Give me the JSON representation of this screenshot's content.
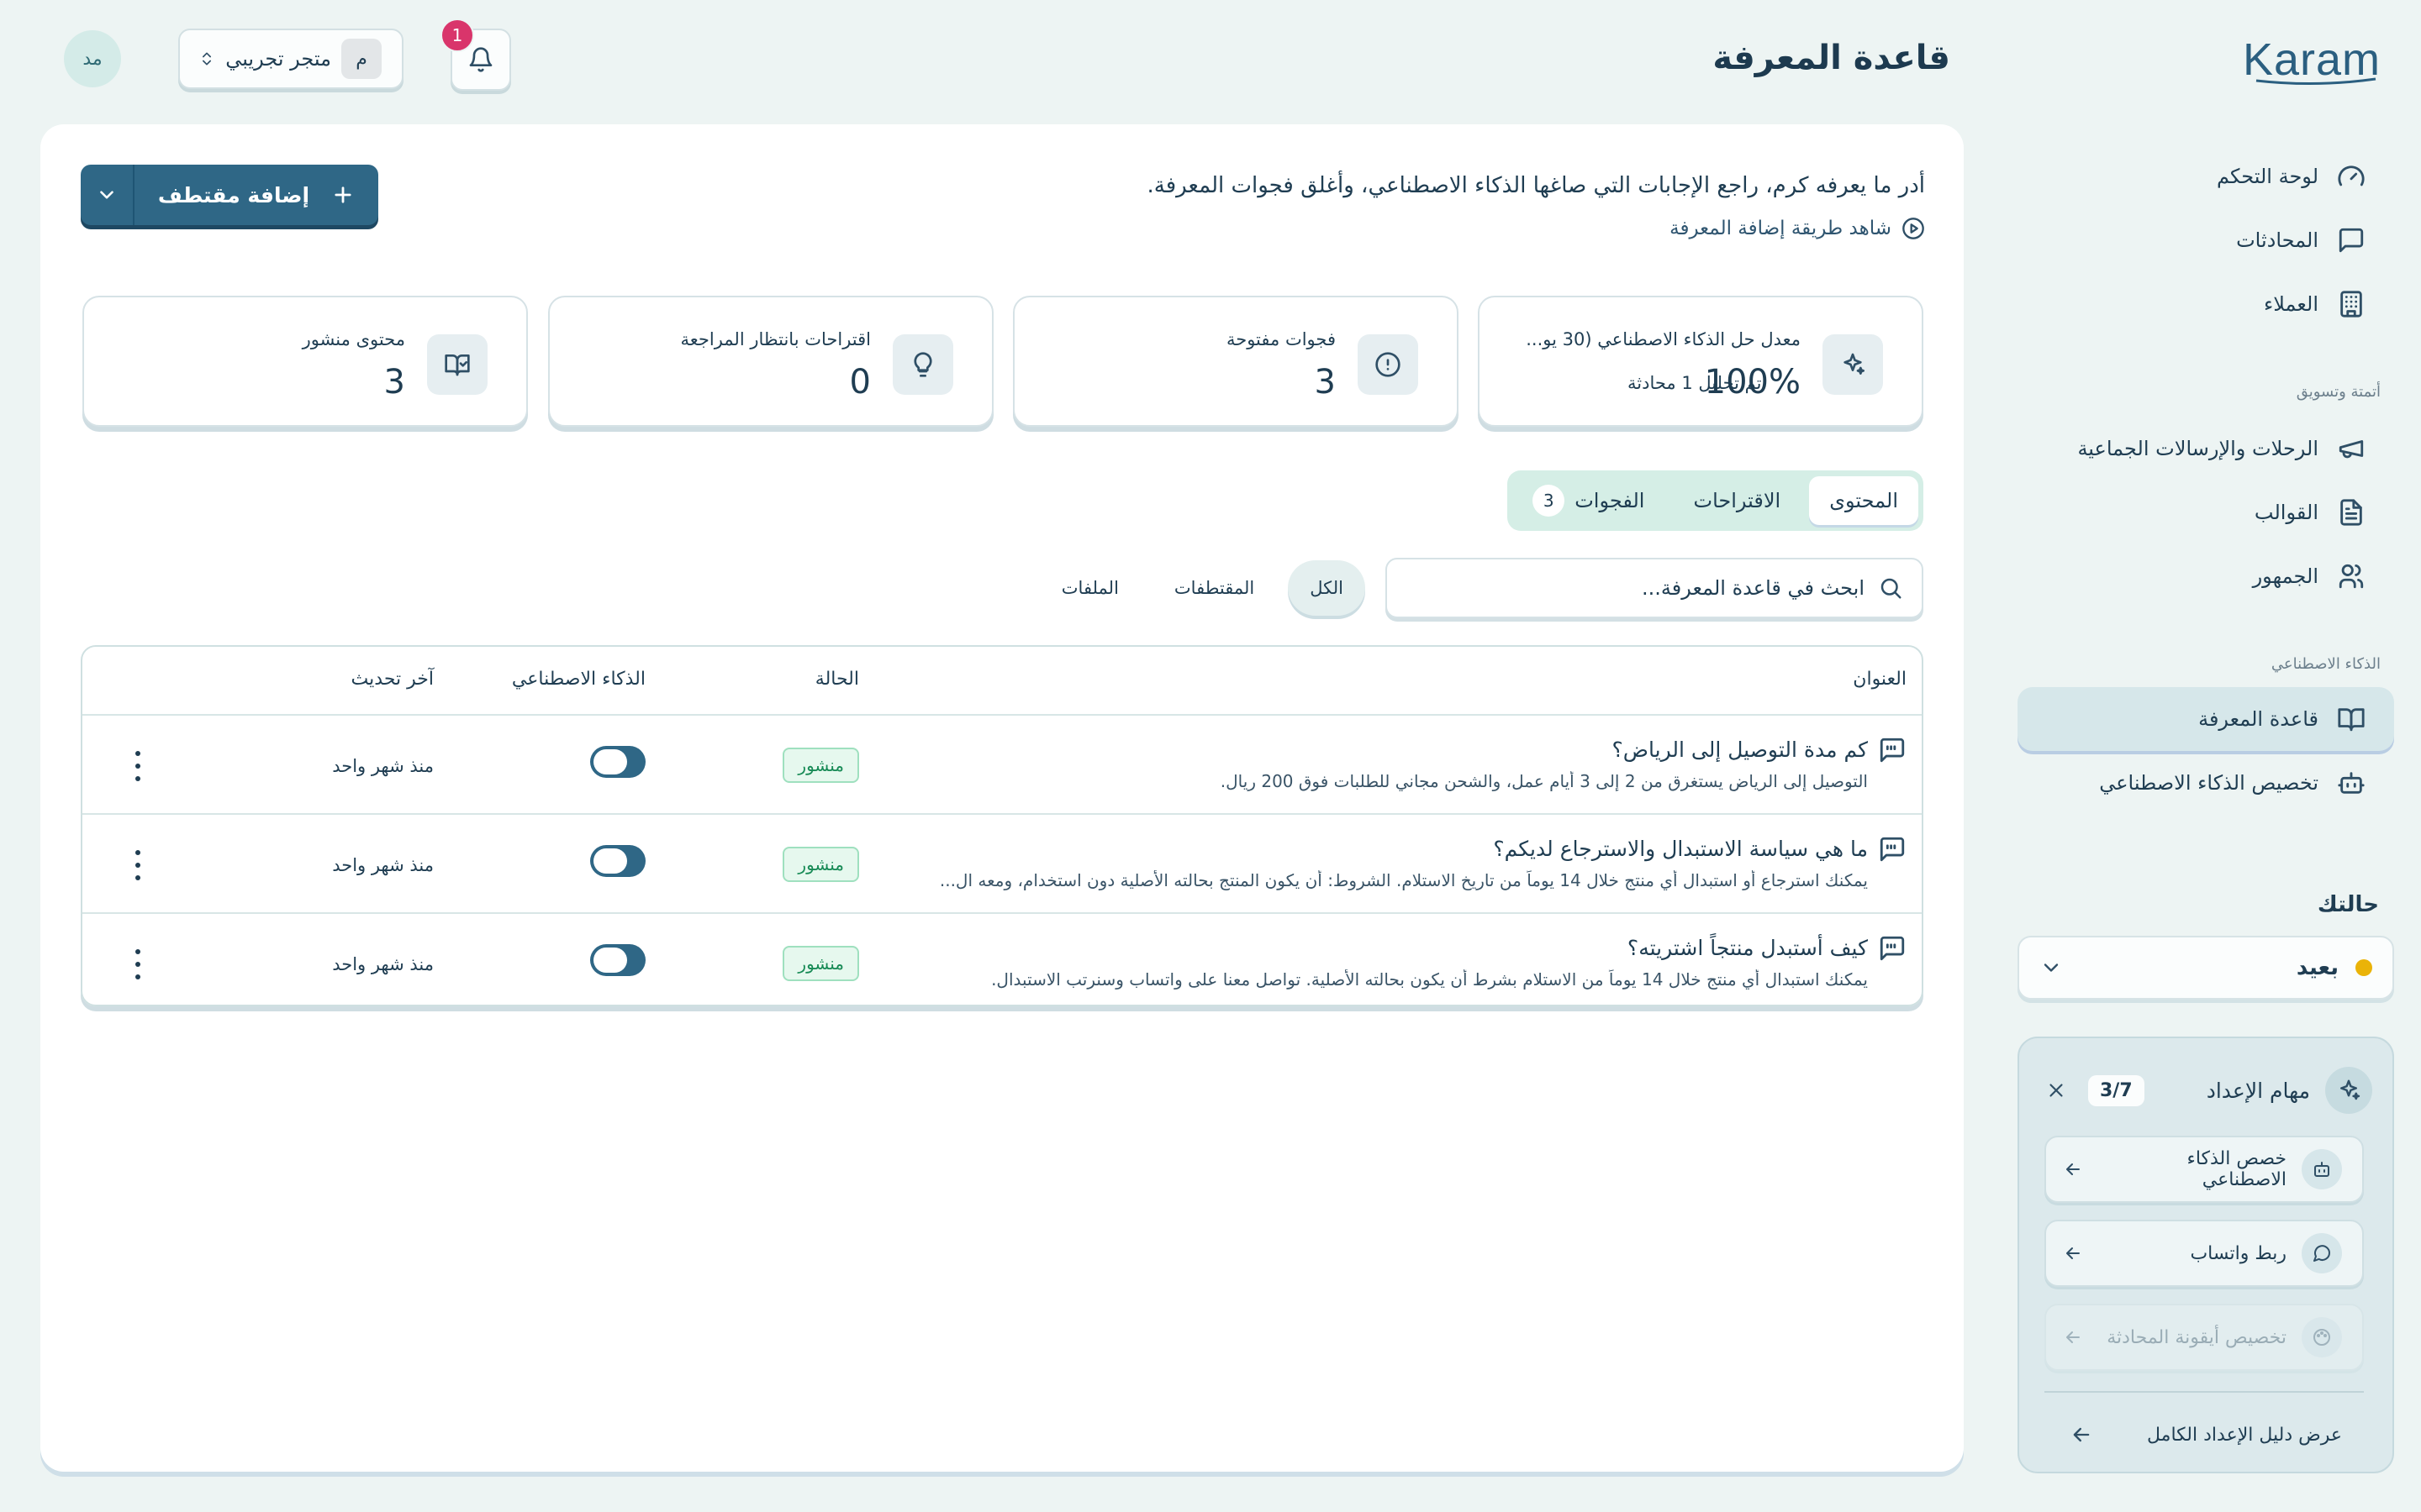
{
  "app": {
    "logo": "Karam"
  },
  "sidebar": {
    "items": [
      {
        "label": "لوحة التحكم",
        "icon": "gauge-icon"
      },
      {
        "label": "المحادثات",
        "icon": "chat-icon"
      },
      {
        "label": "العملاء",
        "icon": "building-icon"
      },
      {
        "label": "الرحلات والإرسالات الجماعية",
        "icon": "megaphone-icon"
      },
      {
        "label": "القوالب",
        "icon": "document-icon"
      },
      {
        "label": "الجمهور",
        "icon": "users-icon"
      },
      {
        "label": "قاعدة المعرفة",
        "icon": "book-icon",
        "active": true
      },
      {
        "label": "تخصيص الذكاء الاصطناعي",
        "icon": "bot-icon"
      }
    ],
    "section_automation": "أتمتة وتسويق",
    "section_ai": "الذكاء الاصطناعي",
    "status": {
      "title": "حالتك",
      "value": "بعيد",
      "dot_color": "#eab308"
    },
    "setup": {
      "title": "مهام الإعداد",
      "count": "3/7",
      "tasks": [
        "خصص الذكاء الاصطناعي",
        "ربط واتساب",
        "تخصيص أيقونة المحادثة"
      ],
      "footer": "عرض دليل الإعداد الكامل"
    }
  },
  "header": {
    "title": "قاعدة المعرفة",
    "notifications": "1",
    "store_avatar": "م",
    "store_name": "متجر تجريبي",
    "user_initials": "مد"
  },
  "main": {
    "intro": "أدر ما يعرفه كرم، راجع الإجابات التي صاغها الذكاء الاصطناعي، وأغلق فجوات المعرفة.",
    "howto": "شاهد طريقة إضافة المعرفة",
    "add_button": "إضافة مقتطف",
    "stats": [
      {
        "label": "معدل حل الذكاء الاصطناعي (30 يو...",
        "value": "100%",
        "sub": "تم تحليل 1 محادثة",
        "icon": "sparkles-icon"
      },
      {
        "label": "فجوات مفتوحة",
        "value": "3",
        "icon": "alert-circle-icon"
      },
      {
        "label": "اقتراحات بانتظار المراجعة",
        "value": "0",
        "icon": "lightbulb-icon"
      },
      {
        "label": "محتوى منشور",
        "value": "3",
        "icon": "book-check-icon"
      }
    ],
    "tabs": [
      {
        "label": "المحتوى",
        "active": true
      },
      {
        "label": "الاقتراحات"
      },
      {
        "label": "الفجوات",
        "badge": "3"
      }
    ],
    "search_placeholder": "ابحث في قاعدة المعرفة...",
    "filters": [
      {
        "label": "الكل",
        "active": true
      },
      {
        "label": "المقتطفات"
      },
      {
        "label": "الملفات"
      }
    ],
    "table": {
      "headers": {
        "title": "العنوان",
        "status": "الحالة",
        "ai": "الذكاء الاصطناعي",
        "updated": "آخر تحديث"
      },
      "rows": [
        {
          "title": "كم مدة التوصيل إلى الرياض؟",
          "desc": "التوصيل إلى الرياض يستغرق من 2 إلى 3 أيام عمل، والشحن مجاني للطلبات فوق 200 ريال.",
          "status": "منشور",
          "updated": "منذ شهر واحد"
        },
        {
          "title": "ما هي سياسة الاستبدال والاسترجاع لديكم؟",
          "desc": "يمكنك استرجاع أو استبدال أي منتج خلال 14 يوماً من تاريخ الاستلام. الشروط: أن يكون المنتج بحالته الأصلية دون استخدام، ومعه ال...",
          "status": "منشور",
          "updated": "منذ شهر واحد"
        },
        {
          "title": "كيف أستبدل منتجاً اشتريته؟",
          "desc": "يمكنك استبدال أي منتج خلال 14 يوماً من الاستلام بشرط أن يكون بحالته الأصلية. تواصل معنا على واتساب وسنرتب الاستبدال.",
          "status": "منشور",
          "updated": "منذ شهر واحد"
        }
      ]
    }
  }
}
